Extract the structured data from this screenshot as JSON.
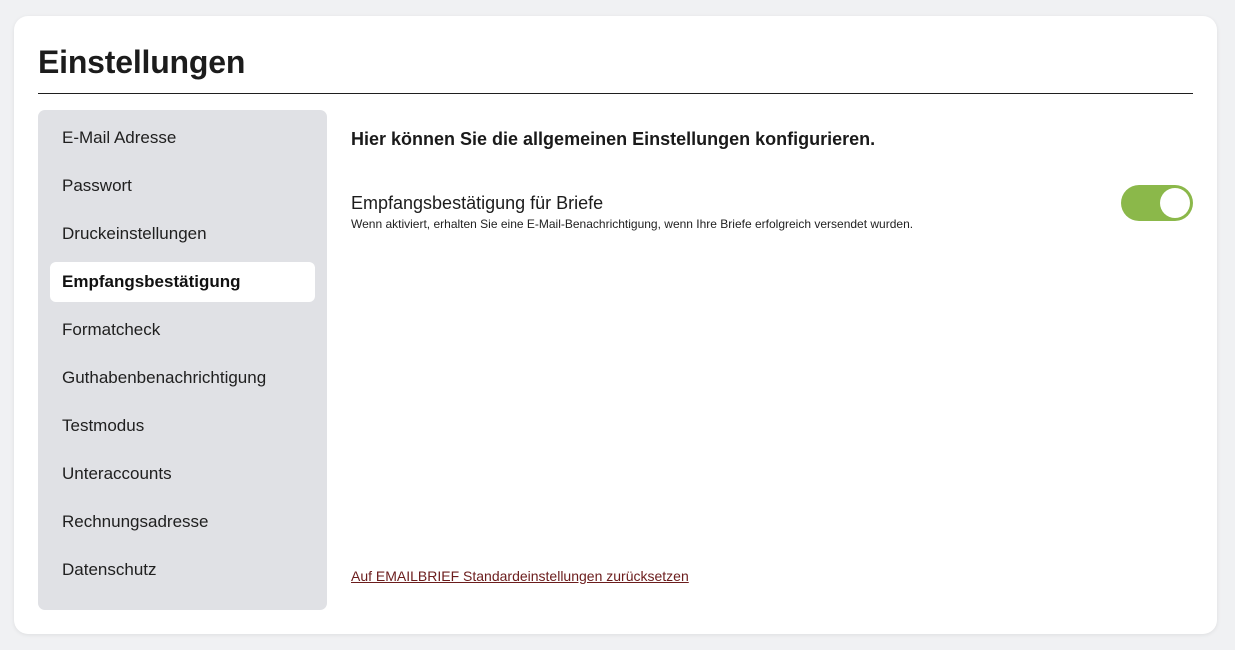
{
  "page": {
    "title": "Einstellungen"
  },
  "sidebar": {
    "items": [
      {
        "label": "E-Mail Adresse",
        "active": false
      },
      {
        "label": "Passwort",
        "active": false
      },
      {
        "label": "Druckeinstellungen",
        "active": false
      },
      {
        "label": "Empfangsbestätigung",
        "active": true
      },
      {
        "label": "Formatcheck",
        "active": false
      },
      {
        "label": "Guthabenbenachrichtigung",
        "active": false
      },
      {
        "label": "Testmodus",
        "active": false
      },
      {
        "label": "Unteraccounts",
        "active": false
      },
      {
        "label": "Rechnungsadresse",
        "active": false
      },
      {
        "label": "Datenschutz",
        "active": false
      }
    ]
  },
  "content": {
    "intro": "Hier können Sie die allgemeinen Einstellungen konfigurieren.",
    "setting": {
      "title": "Empfangsbestätigung für Briefe",
      "description": "Wenn aktiviert, erhalten Sie eine E-Mail-Benachrichtigung, wenn Ihre Briefe erfolgreich versendet wurden.",
      "enabled": true,
      "toggle_color": "#8bb84a"
    },
    "reset_link": "Auf EMAILBRIEF Standardeinstellungen zurücksetzen"
  },
  "colors": {
    "background": "#f0f1f3",
    "sidebar_bg": "#e0e1e5",
    "link": "#6b1c1c"
  }
}
